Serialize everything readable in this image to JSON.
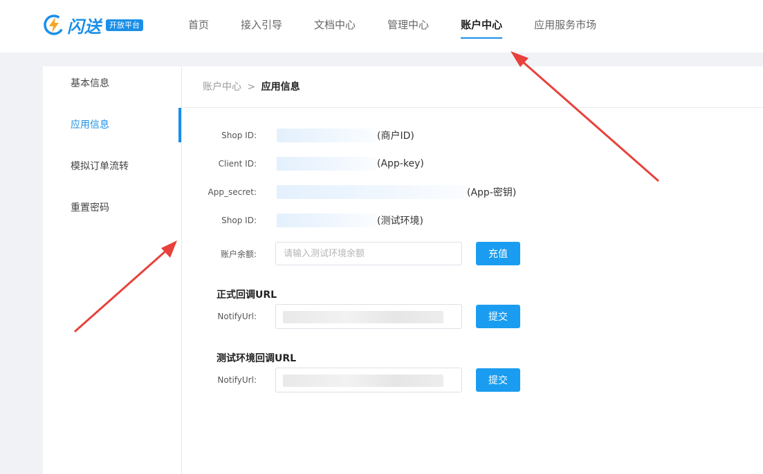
{
  "header": {
    "logo_text": "闪送",
    "logo_badge": "开放平台",
    "nav": [
      {
        "label": "首页"
      },
      {
        "label": "接入引导"
      },
      {
        "label": "文档中心"
      },
      {
        "label": "管理中心"
      },
      {
        "label": "账户中心"
      },
      {
        "label": "应用服务市场"
      }
    ],
    "active_nav": "账户中心"
  },
  "sidebar": {
    "items": [
      {
        "label": "基本信息"
      },
      {
        "label": "应用信息"
      },
      {
        "label": "模拟订单流转"
      },
      {
        "label": "重置密码"
      }
    ],
    "active_item": "应用信息"
  },
  "breadcrumb": {
    "parent": "账户中心",
    "separator": ">",
    "current": "应用信息"
  },
  "app_info": {
    "rows": [
      {
        "label": "Shop ID:",
        "note": "(商户ID)"
      },
      {
        "label": "Client ID:",
        "note": "(App-key)"
      },
      {
        "label": "App_secret:",
        "note": "(App-密钥)"
      },
      {
        "label": "Shop ID:",
        "note": "(测试环境)"
      }
    ]
  },
  "balance": {
    "label": "账户余额:",
    "placeholder": "请输入测试环境余额",
    "button_label": "充值"
  },
  "callback_prod": {
    "title": "正式回调URL",
    "label": "NotifyUrl:",
    "button_label": "提交"
  },
  "callback_test": {
    "title": "测试环境回调URL",
    "label": "NotifyUrl:",
    "button_label": "提交"
  },
  "colors": {
    "accent": "#1a8fe8",
    "button": "#1a9df0",
    "annotation_arrow": "#e8403a"
  }
}
